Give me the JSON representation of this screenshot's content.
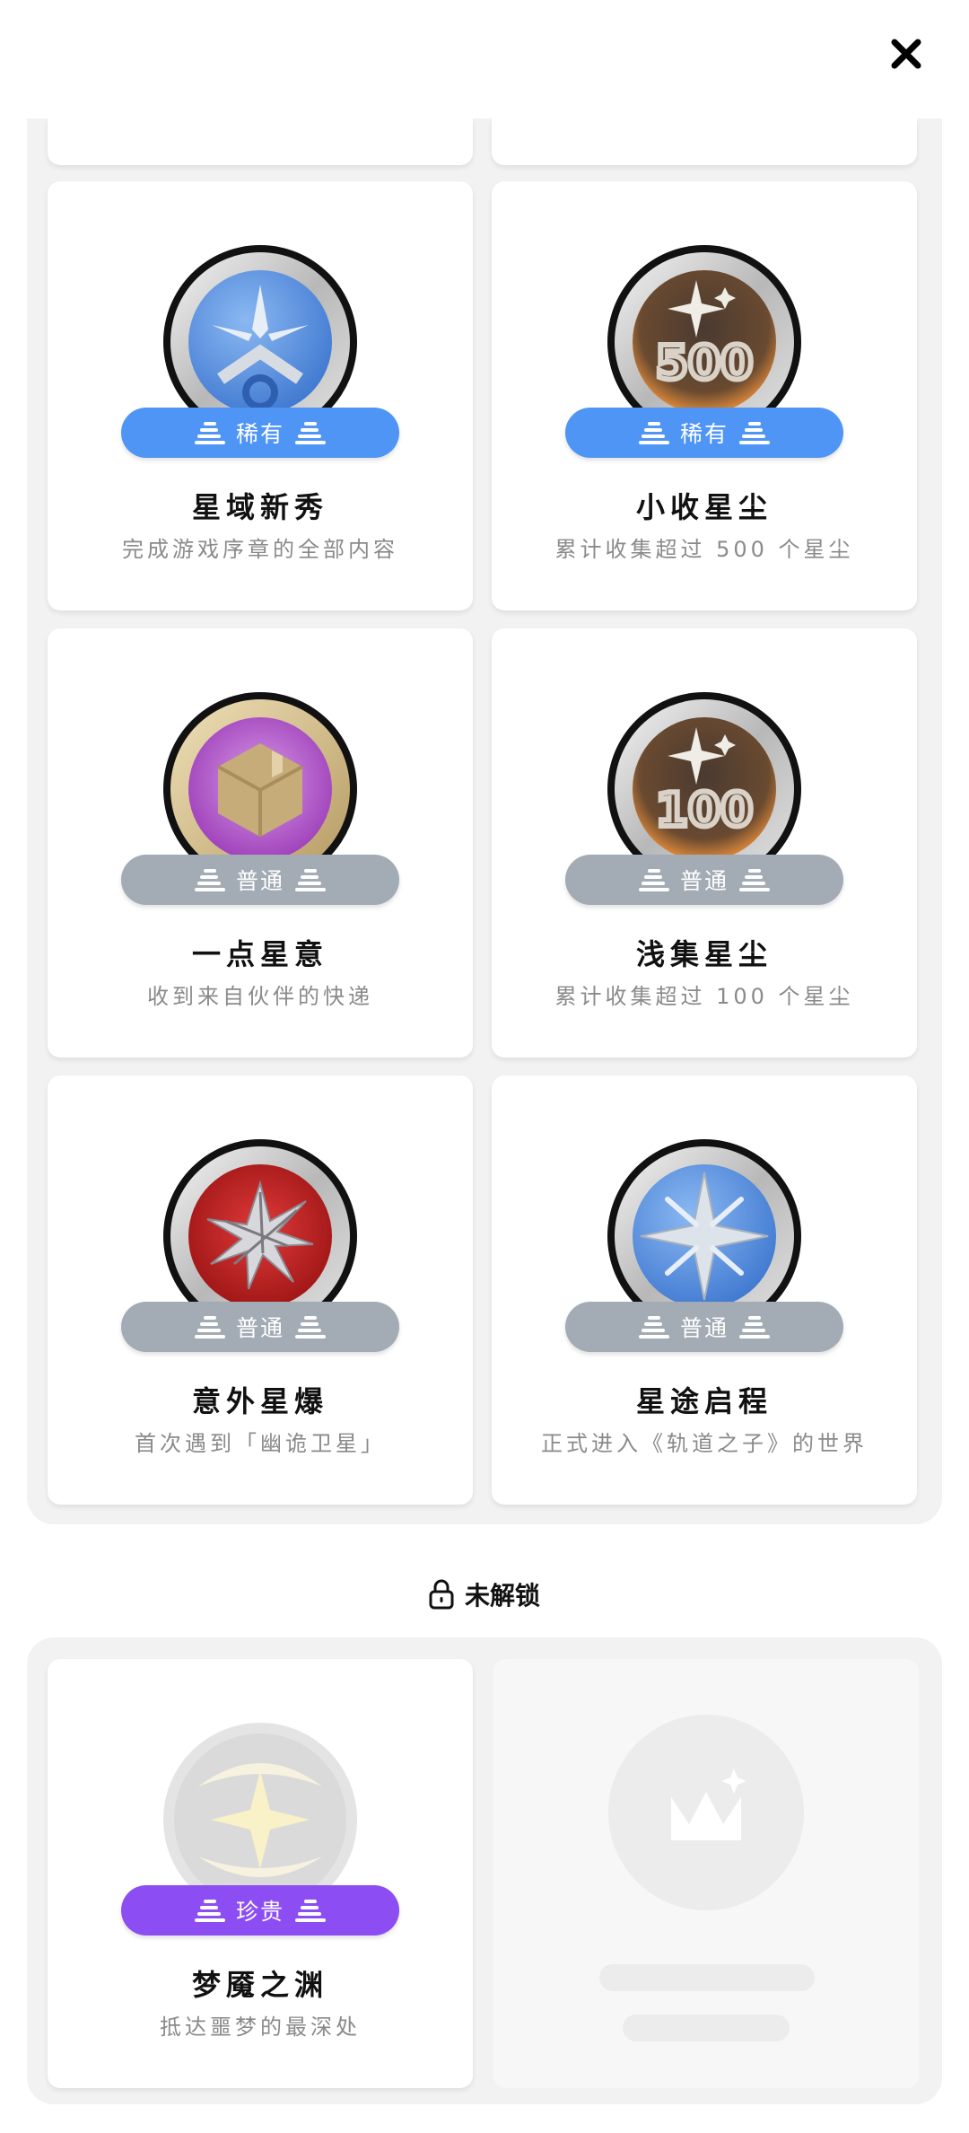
{
  "header": {
    "close_icon": "close-icon"
  },
  "unlocked": {
    "badges": [
      {
        "title": "星域新秀",
        "desc": "完成游戏序章的全部内容",
        "rarity": "稀有",
        "rarity_color": "#4f95f5",
        "icon": "compass-emblem-icon"
      },
      {
        "title": "小收星尘",
        "desc": "累计收集超过 500 个星尘",
        "rarity": "稀有",
        "rarity_color": "#4f95f5",
        "icon": "stardust-500-icon"
      },
      {
        "title": "一点星意",
        "desc": "收到来自伙伴的快递",
        "rarity": "普通",
        "rarity_color": "#a3abb4",
        "icon": "package-box-icon"
      },
      {
        "title": "浅集星尘",
        "desc": "累计收集超过 100 个星尘",
        "rarity": "普通",
        "rarity_color": "#a3abb4",
        "icon": "stardust-100-icon"
      },
      {
        "title": "意外星爆",
        "desc": "首次遇到「幽诡卫星」",
        "rarity": "普通",
        "rarity_color": "#a3abb4",
        "icon": "star-burst-icon"
      },
      {
        "title": "星途启程",
        "desc": "正式进入《轨道之子》的世界",
        "rarity": "普通",
        "rarity_color": "#a3abb4",
        "icon": "compass-star-icon"
      }
    ]
  },
  "locked_section": {
    "label": "未解锁",
    "icon": "lock-icon",
    "badges": [
      {
        "title": "梦魇之渊",
        "desc": "抵达噩梦的最深处",
        "rarity": "珍贵",
        "rarity_color": "#8c4ef3",
        "icon": "nightmare-star-icon"
      }
    ]
  },
  "colors": {
    "rare": "#4f95f5",
    "common": "#a3abb4",
    "precious": "#8c4ef3",
    "panel_bg": "#f2f2f2"
  }
}
